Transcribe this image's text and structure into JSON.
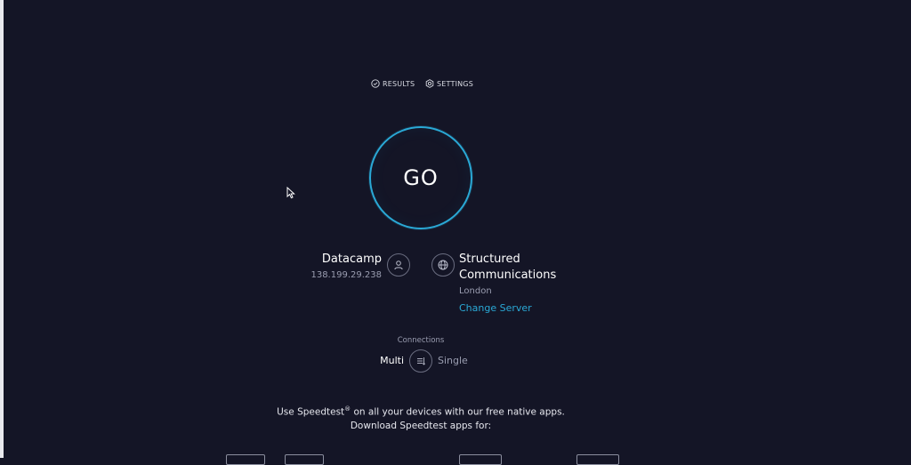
{
  "nav": {
    "results_label": "RESULTS",
    "settings_label": "SETTINGS"
  },
  "go": {
    "label": "GO"
  },
  "isp": {
    "name": "Datacamp",
    "ip": "138.199.29.238"
  },
  "server": {
    "name": "Structured Communications",
    "location": "London",
    "change_label": "Change Server"
  },
  "connections": {
    "label": "Connections",
    "multi_label": "Multi",
    "single_label": "Single"
  },
  "promo": {
    "line1_prefix": "Use Speedtest",
    "registered": "®",
    "line1_suffix": " on all your devices with our free native apps.",
    "line2": "Download Speedtest apps for:"
  },
  "colors": {
    "background": "#141526",
    "accent": "#2aa9d6"
  }
}
